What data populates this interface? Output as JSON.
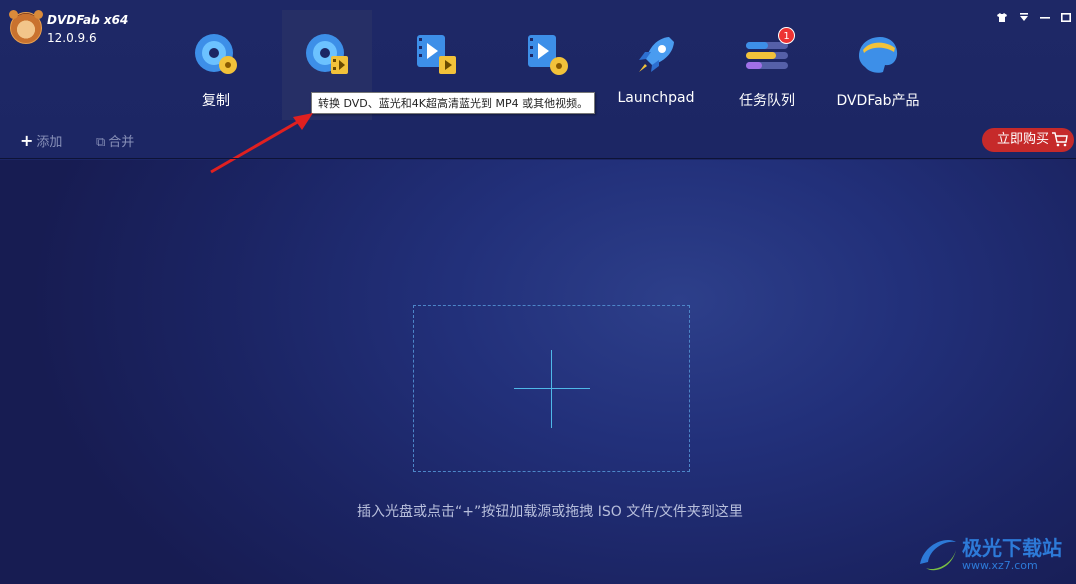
{
  "app": {
    "brand": "DVDFab x64",
    "version": "12.0.9.6"
  },
  "window_controls": [
    "shirt-icon",
    "dropdown-icon",
    "minimize-icon",
    "maximize-icon"
  ],
  "tabs": [
    {
      "label": "复制",
      "icon": "disc-icon"
    },
    {
      "label": "转",
      "icon": "disc-film-icon",
      "active": true
    },
    {
      "label": "",
      "icon": "film-icon"
    },
    {
      "label": "",
      "icon": "film-disc-icon"
    },
    {
      "label": "Launchpad",
      "icon": "rocket-icon"
    },
    {
      "label": "任务队列",
      "icon": "task-list-icon",
      "badge": "1"
    },
    {
      "label": "DVDFab产品",
      "icon": "dvdfab-products-icon"
    }
  ],
  "tooltip": "转换 DVD、蓝光和4K超高清蓝光到 MP4 或其他视频。",
  "toolbar": {
    "add": "添加",
    "merge": "合并",
    "buy": "立即购买"
  },
  "dropzone": {
    "hint": "插入光盘或点击“+”按钮加载源或拖拽 ISO 文件/文件夹到这里"
  },
  "watermark": {
    "title": "极光下载站",
    "url": "www.xz7.com"
  },
  "colors": {
    "accent": "#4fb8e8",
    "buy": "#c62a2a",
    "arrow": "#e02020"
  }
}
